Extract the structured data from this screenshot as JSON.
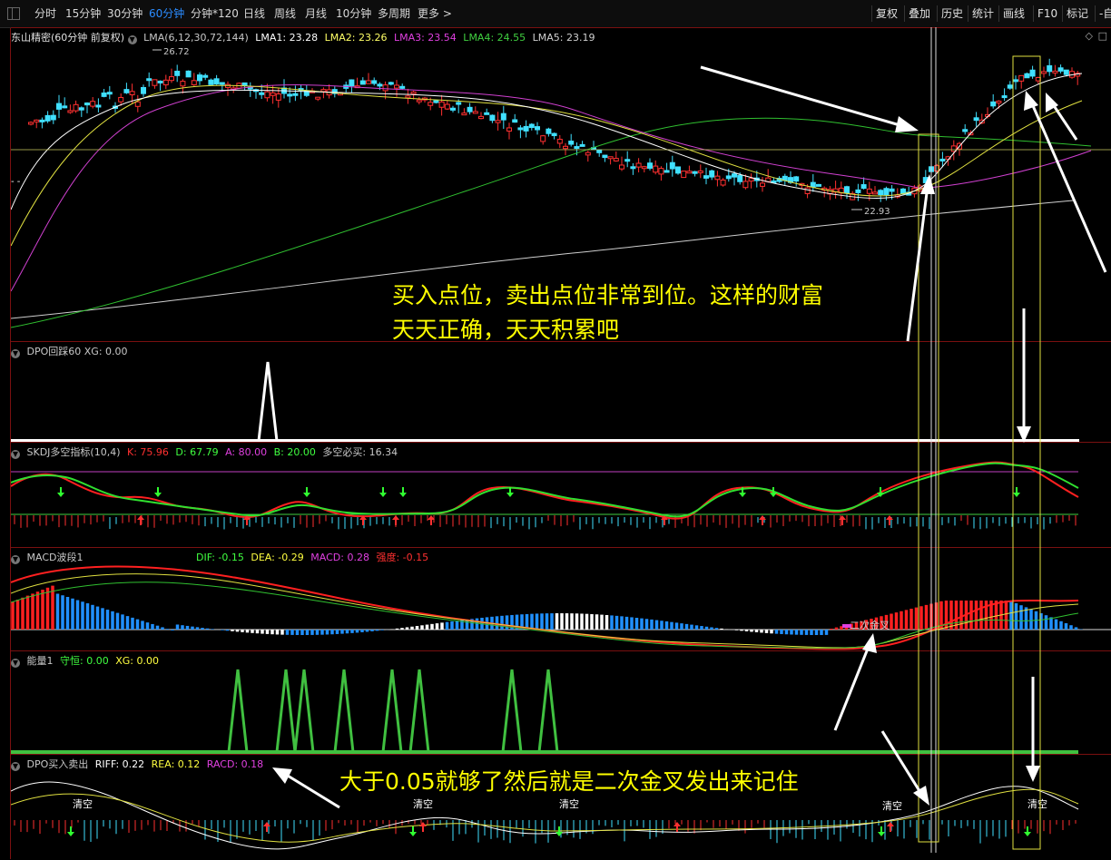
{
  "periods": [
    "分时",
    "15分钟",
    "30分钟",
    "60分钟",
    "分钟*120",
    "日线",
    "周线",
    "月线",
    "10分钟",
    "多周期",
    "更多 >"
  ],
  "active_period": "60分钟",
  "toolbar_right": [
    "复权",
    "叠加",
    "历史",
    "统计",
    "画线",
    "F10",
    "标记",
    "-自"
  ],
  "main": {
    "title": "东山精密(60分钟 前复权)",
    "lma_label": "LMA(6,12,30,72,144)",
    "lma": [
      {
        "label": "LMA1: 23.28",
        "color": "#ffffff"
      },
      {
        "label": "LMA2: 23.26",
        "color": "#ffff66"
      },
      {
        "label": "LMA3: 23.54",
        "color": "#e040e0"
      },
      {
        "label": "LMA4: 24.55",
        "color": "#40d040"
      },
      {
        "label": "LMA5: 23.19",
        "color": "#d0d0d0"
      }
    ],
    "high_label": "26.72",
    "low_label": "22.93"
  },
  "dpo_panel": {
    "title": "DPO回踩60",
    "xg": "XG: 0.00"
  },
  "skdj_panel": {
    "title": "SKDJ多空指标(10,4)",
    "values": [
      {
        "label": "K: 75.96",
        "color": "#ff3030"
      },
      {
        "label": "D: 67.79",
        "color": "#40ff40"
      },
      {
        "label": "A: 80.00",
        "color": "#e040e0"
      },
      {
        "label": "B: 20.00",
        "color": "#40ff40"
      },
      {
        "label": "多空必买: 16.34",
        "color": "#c8c8c8"
      }
    ]
  },
  "macd_panel": {
    "title": "MACD波段1",
    "values": [
      {
        "label": "DIF: -0.15",
        "color": "#40ff40"
      },
      {
        "label": "DEA: -0.29",
        "color": "#ffff40"
      },
      {
        "label": "MACD: 0.28",
        "color": "#e040e0"
      },
      {
        "label": "强度: -0.15",
        "color": "#ff3030"
      }
    ],
    "cross_label": "二次金叉"
  },
  "energy_panel": {
    "title": "能量1",
    "values": [
      {
        "label": "守恒: 0.00",
        "color": "#40ff40"
      },
      {
        "label": "XG: 0.00",
        "color": "#ffff40"
      }
    ]
  },
  "trade_panel": {
    "title": "DPO买入卖出",
    "values": [
      {
        "label": "RIFF: 0.22",
        "color": "#ffffff"
      },
      {
        "label": "REA: 0.12",
        "color": "#ffff40"
      },
      {
        "label": "RACD: 0.18",
        "color": "#e040e0"
      }
    ],
    "clear_label": "清空"
  },
  "annotations": {
    "main_line1": "买入点位，卖出点位非常到位。这样的财富",
    "main_line2": "天天正确，天天积累吧",
    "bottom": "大于0.05就够了然后就是二次金叉发出来记住"
  },
  "colors": {
    "up": "#ff3030",
    "down": "#40e0ff",
    "annotation": "#ffff00",
    "frame": "#7a1010"
  }
}
